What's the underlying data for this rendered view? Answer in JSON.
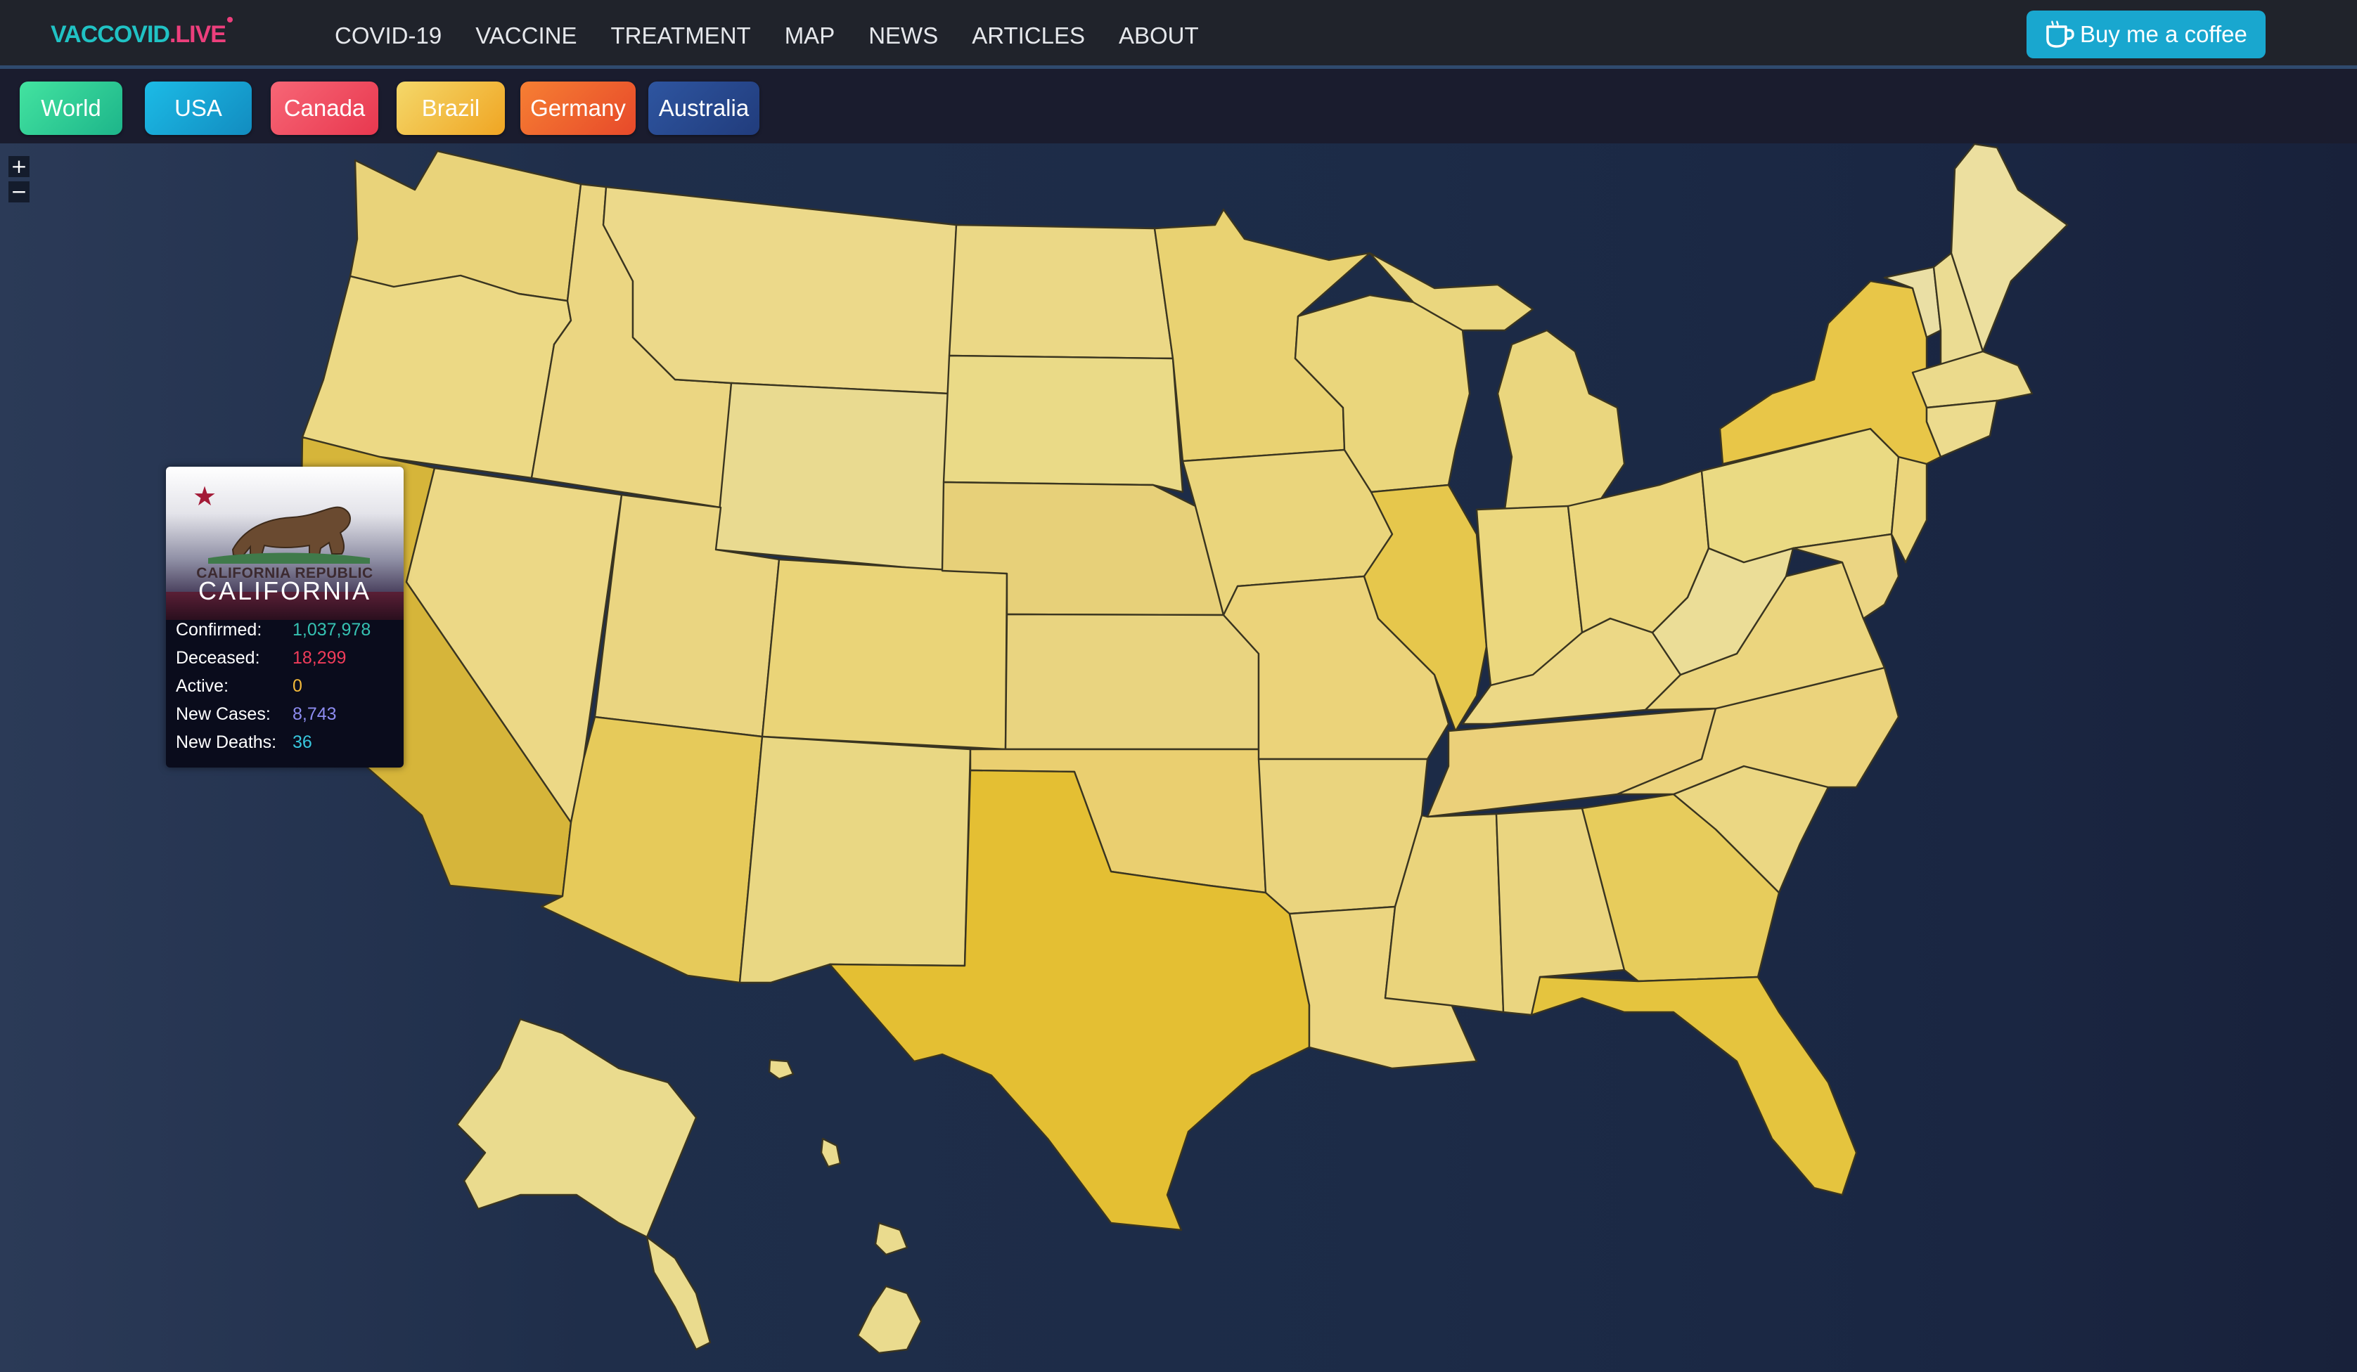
{
  "brand": {
    "name_main": "VACCOVID",
    "name_suffix": ".LIVE",
    "color_main": "#20c2c4",
    "color_suffix": "#ec3f7c"
  },
  "nav": {
    "items": [
      "COVID-19",
      "VACCINE",
      "TREATMENT",
      "MAP",
      "NEWS",
      "ARTICLES",
      "ABOUT"
    ]
  },
  "coffee_button": {
    "label": "Buy me a coffee",
    "icon": "coffee-cup-icon"
  },
  "region_tabs": [
    {
      "label": "World",
      "gradient": [
        "#3ee09a",
        "#1fb589"
      ]
    },
    {
      "label": "USA",
      "gradient": [
        "#18b2e0",
        "#1590c4"
      ]
    },
    {
      "label": "Canada",
      "gradient": [
        "#f55c6e",
        "#e93a52"
      ]
    },
    {
      "label": "Brazil",
      "gradient": [
        "#f3d160",
        "#f0a825"
      ]
    },
    {
      "label": "Germany",
      "gradient": [
        "#f5772e",
        "#e84f2b"
      ]
    },
    {
      "label": "Australia",
      "gradient": [
        "#2b4f98",
        "#233f80"
      ]
    }
  ],
  "map": {
    "zoom_in": "+",
    "zoom_out": "−",
    "selected_region": "California"
  },
  "tooltip": {
    "flag_text": "CALIFORNIA REPUBLIC",
    "state_name": "CALIFORNIA",
    "stats": [
      {
        "label": "Confirmed:",
        "value": "1,037,978",
        "color": "#36c2b2"
      },
      {
        "label": "Deceased:",
        "value": "18,299",
        "color": "#f03c5a"
      },
      {
        "label": "Active:",
        "value": "0",
        "color": "#f2b93a"
      },
      {
        "label": "New Cases:",
        "value": "8,743",
        "color": "#8d8cf0"
      },
      {
        "label": "New Deaths:",
        "value": "36",
        "color": "#38c7dd"
      }
    ]
  }
}
